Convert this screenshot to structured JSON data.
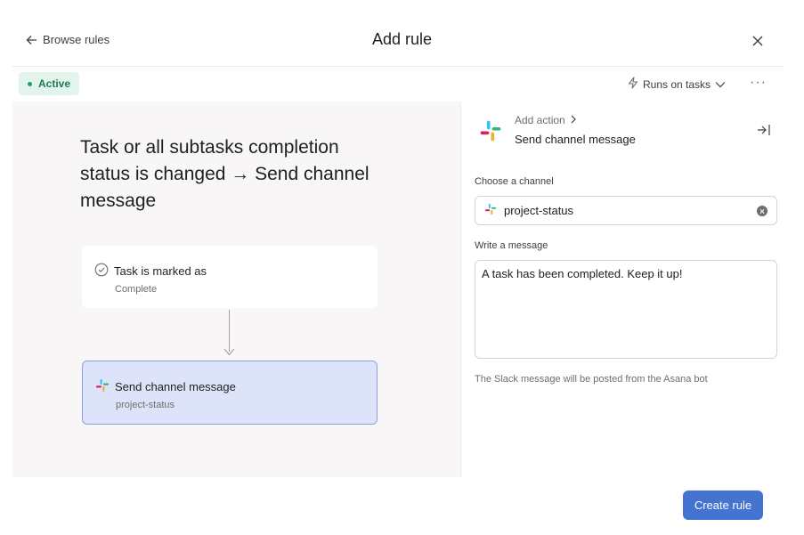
{
  "header": {
    "back_label": "Browse rules",
    "title": "Add rule"
  },
  "toolbar": {
    "status_label": "Active",
    "runs_label": "Runs on tasks",
    "more_label": "···"
  },
  "canvas": {
    "heading": "Task or all subtasks completion status is changed → Send channel message",
    "trigger": {
      "title": "Task is marked as",
      "subtitle": "Complete"
    },
    "action": {
      "title": "Send channel message",
      "subtitle": "project-status"
    }
  },
  "panel": {
    "breadcrumb": "Add action",
    "title": "Send channel message",
    "channel_label": "Choose a channel",
    "channel_value": "project-status",
    "message_label": "Write a message",
    "message_value": "A task has been completed. Keep it up!",
    "hint": "The Slack message will be posted from the Asana bot"
  },
  "footer": {
    "create_label": "Create rule"
  },
  "colors": {
    "accent": "#4573d2",
    "active_green": "#1f7a52",
    "selected_node": "#dde4fa",
    "slack_blue": "#36c5f0",
    "slack_green": "#2eb67d",
    "slack_red": "#e01e5a",
    "slack_yellow": "#ecb22e"
  }
}
